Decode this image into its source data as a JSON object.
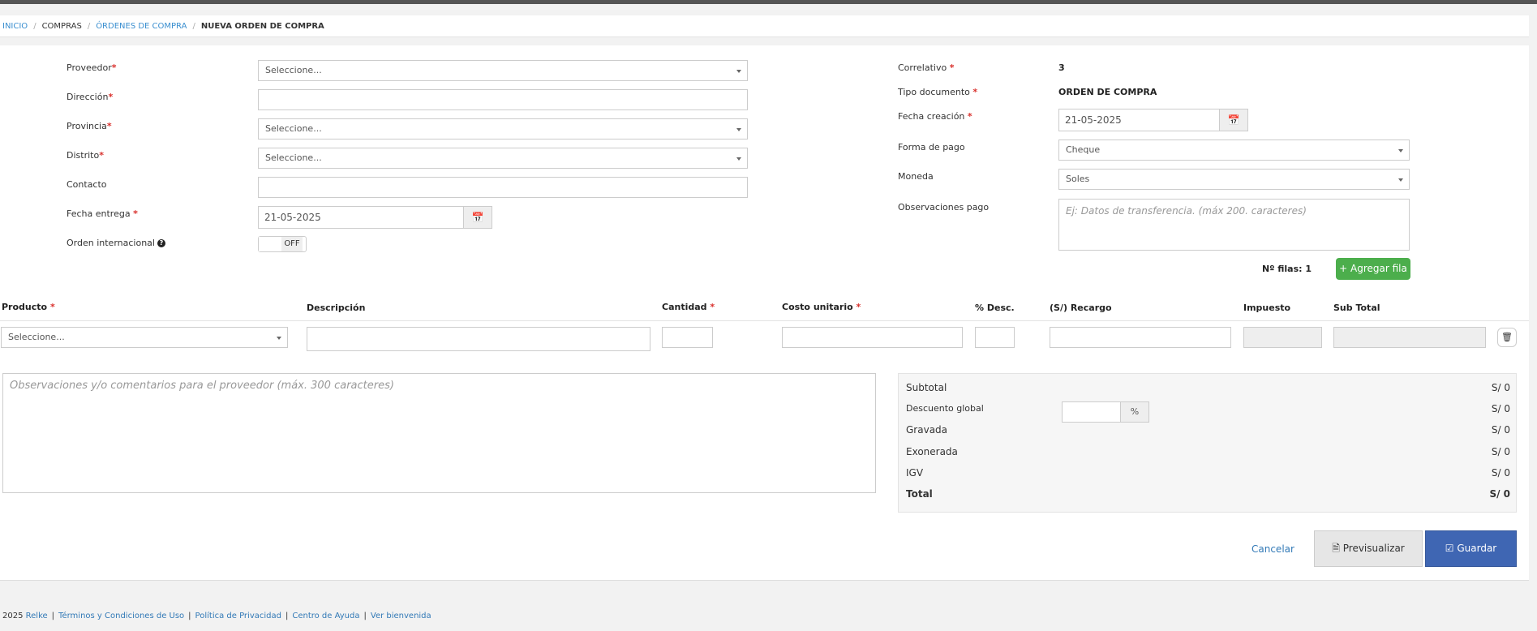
{
  "breadcrumb": {
    "items": [
      "INICIO",
      "COMPRAS",
      "ÓRDENES DE COMPRA",
      "NUEVA ORDEN DE COMPRA"
    ],
    "separator": "/"
  },
  "form": {
    "proveedor_label": "Proveedor",
    "proveedor_placeholder": "Seleccione...",
    "direccion_label": "Dirección",
    "provincia_label": "Provincia",
    "provincia_placeholder": "Seleccione...",
    "distrito_label": "Distrito",
    "distrito_placeholder": "Seleccione...",
    "contacto_label": "Contacto",
    "fecha_entrega_label": "Fecha entrega",
    "fecha_entrega_value": "21-05-2025",
    "orden_internacional_label": "Orden internacional",
    "orden_internacional_state": "OFF",
    "required_mark": "*",
    "info_glyph": "?"
  },
  "doc": {
    "correlativo_label": "Correlativo",
    "correlativo_value": "3",
    "tipo_documento_label": "Tipo documento",
    "tipo_documento_value": "ORDEN DE COMPRA",
    "fecha_creacion_label": "Fecha creación",
    "fecha_creacion_value": "21-05-2025",
    "forma_pago_label": "Forma de pago",
    "forma_pago_value": "Cheque",
    "moneda_label": "Moneda",
    "moneda_value": "Soles",
    "observaciones_pago_label": "Observaciones pago",
    "observaciones_pago_placeholder": "Ej: Datos de transferencia. (máx 200. caracteres)",
    "filas_label": "Nº filas: 1",
    "agregar_fila_label": "+ Agregar fila"
  },
  "table": {
    "columns": {
      "producto": "Producto",
      "descripcion": "Descripción",
      "cantidad": "Cantidad",
      "costo_unitario": "Costo unitario",
      "desc": "% Desc.",
      "recargo": "(S/) Recargo",
      "impuesto": "Impuesto",
      "subtotal": "Sub Total"
    },
    "producto_placeholder": "Seleccione..."
  },
  "comments": {
    "placeholder": "Observaciones y/o comentarios para el proveedor (máx. 300 caracteres)"
  },
  "summary": {
    "subtotal_label": "Subtotal",
    "subtotal_value": "S/ 0",
    "descuento_label": "Descuento global",
    "descuento_unit": "%",
    "descuento_value": "S/ 0",
    "gravada_label": "Gravada",
    "gravada_value": "S/ 0",
    "exonerada_label": "Exonerada",
    "exonerada_value": "S/ 0",
    "igv_label": "IGV",
    "igv_value": "S/ 0",
    "total_label": "Total",
    "total_value": "S/ 0"
  },
  "actions": {
    "cancel": "Cancelar",
    "preview": "Previsualizar",
    "save": "Guardar"
  },
  "footer": {
    "year": "2025",
    "brand": "Relke",
    "links": [
      "Términos y Condiciones de Uso",
      "Política de Privacidad",
      "Centro de Ayuda",
      "Ver bienvenida"
    ],
    "separator": "|"
  },
  "colors": {
    "primary_blue": "#3f66b3",
    "green": "#4cae4c",
    "link": "#337ab7",
    "required": "#d9302c"
  },
  "icons": [
    "calendar-icon",
    "trash-icon",
    "plus-icon",
    "file-icon",
    "check-icon",
    "info-icon",
    "chevron-down-icon"
  ]
}
